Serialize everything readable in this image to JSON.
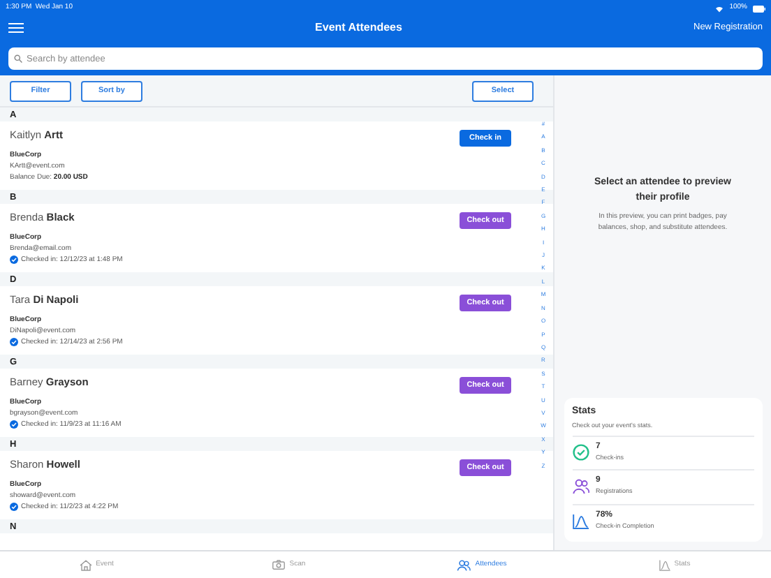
{
  "status_bar": {
    "time": "1:30 PM",
    "date": "Wed Jan 10",
    "battery": "100%"
  },
  "header": {
    "title": "Event Attendees",
    "action": "New Registration"
  },
  "search": {
    "placeholder": "Search by attendee"
  },
  "toolbar": {
    "buttons": [
      "Filter",
      "Sort by"
    ],
    "select": "Select"
  },
  "sections": [
    {
      "letter": "A",
      "attendees": [
        {
          "name": "Kaitlyn **Artt**",
          "company": "BlueCorp",
          "email": "KArtt@event.com",
          "checked_in": false,
          "info": "Balance Due: **20.00 USD**",
          "button": "Check in"
        }
      ]
    },
    {
      "letter": "B",
      "attendees": [
        {
          "name": "Brenda **Black**",
          "company": "BlueCorp",
          "email": "Brenda@email.com",
          "checked_in": true,
          "info": "Checked in: 12/12/23 at 1:48 PM",
          "button": "Check out"
        }
      ]
    },
    {
      "letter": "D",
      "attendees": [
        {
          "name": "Tara **Di Napoli**",
          "company": "BlueCorp",
          "email": "DiNapoli@event.com",
          "checked_in": true,
          "info": "Checked in: 12/14/23 at 2:56 PM",
          "button": "Check out"
        }
      ]
    },
    {
      "letter": "G",
      "attendees": [
        {
          "name": "Barney **Grayson**",
          "company": "BlueCorp",
          "email": "bgrayson@event.com",
          "checked_in": true,
          "info": "Checked in: 11/9/23 at 11:16 AM",
          "button": "Check out"
        }
      ]
    },
    {
      "letter": "H",
      "attendees": [
        {
          "name": "Sharon **Howell**",
          "company": "BlueCorp",
          "email": "showard@event.com",
          "checked_in": true,
          "info": "Checked in: 11/2/23 at 4:22 PM",
          "button": "Check out"
        }
      ]
    },
    {
      "letter": "N"
    }
  ],
  "index": [
    "#",
    "A",
    "B",
    "C",
    "D",
    "E",
    "F",
    "G",
    "H",
    "I",
    "J",
    "K",
    "L",
    "M",
    "N",
    "O",
    "P",
    "Q",
    "R",
    "S",
    "T",
    "U",
    "V",
    "W",
    "X",
    "Y",
    "Z"
  ],
  "preview": {
    "title": "Select an attendee to preview their profile",
    "text": "In this preview, you can print badges, pay balances, shop, and substitute attendees."
  },
  "stats": {
    "title": "Stats",
    "subtitle": "Check out your event's stats.",
    "items": [
      {
        "kind": "checkins",
        "value": "7",
        "label": "Check-ins"
      },
      {
        "kind": "registrations",
        "value": "9",
        "label": "Registrations"
      },
      {
        "kind": "completion",
        "value": "78%",
        "label": "Check-in Completion"
      }
    ]
  },
  "tabs": [
    {
      "kind": "event",
      "label": "Event",
      "selected": false
    },
    {
      "kind": "scan",
      "label": "Scan",
      "selected": false
    },
    {
      "kind": "attendees",
      "label": "Attendees",
      "selected": true
    },
    {
      "kind": "stats",
      "label": "Stats",
      "selected": false
    }
  ]
}
